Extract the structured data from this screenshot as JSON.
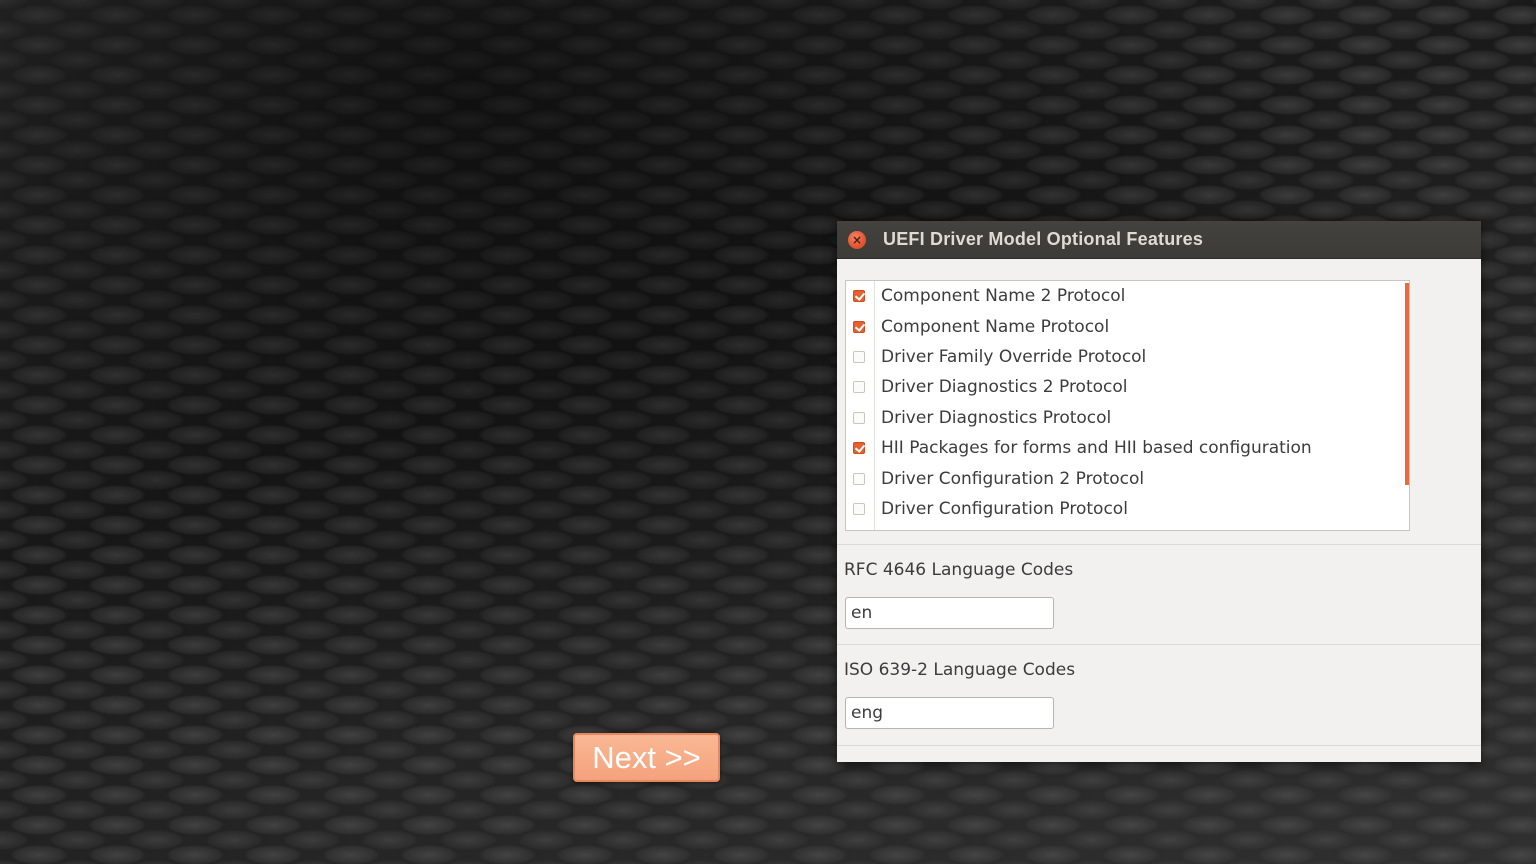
{
  "dialog": {
    "title": "UEFI Driver Model Optional Features",
    "close_icon": "close-icon",
    "protocols": [
      {
        "label": "Component Name 2 Protocol",
        "checked": true
      },
      {
        "label": "Component Name Protocol",
        "checked": true
      },
      {
        "label": "Driver Family Override Protocol",
        "checked": false
      },
      {
        "label": "Driver Diagnostics 2 Protocol",
        "checked": false
      },
      {
        "label": "Driver Diagnostics Protocol",
        "checked": false
      },
      {
        "label": "HII Packages for forms and HII based configuration",
        "checked": true
      },
      {
        "label": "Driver Configuration 2 Protocol",
        "checked": false
      },
      {
        "label": "Driver Configuration Protocol",
        "checked": false
      }
    ],
    "rfc_label": "RFC 4646 Language Codes",
    "rfc_value": "en",
    "iso_label": "ISO 639-2 Language Codes",
    "iso_value": "eng"
  },
  "next_button": {
    "label": "Next >>"
  },
  "colors": {
    "accent": "#e9602f",
    "next_button": "#f4a27c",
    "titlebar": "#3c3b37"
  }
}
